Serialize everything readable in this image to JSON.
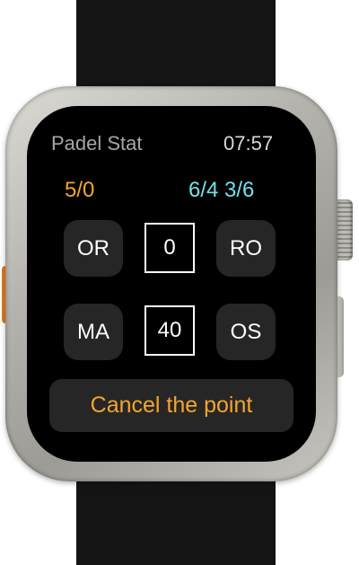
{
  "header": {
    "app_title": "Padel Stat",
    "time": "07:57"
  },
  "scores": {
    "left": "5/0",
    "right": "6/4 3/6"
  },
  "buttons": {
    "top_left": "OR",
    "top_right": "RO",
    "bottom_left": "MA",
    "bottom_right": "OS"
  },
  "points": {
    "top": "0",
    "bottom": "40"
  },
  "cancel_label": "Cancel the point",
  "colors": {
    "accent_orange": "#f4a62a",
    "accent_cyan": "#6fe3e8",
    "button_bg": "#262626"
  }
}
